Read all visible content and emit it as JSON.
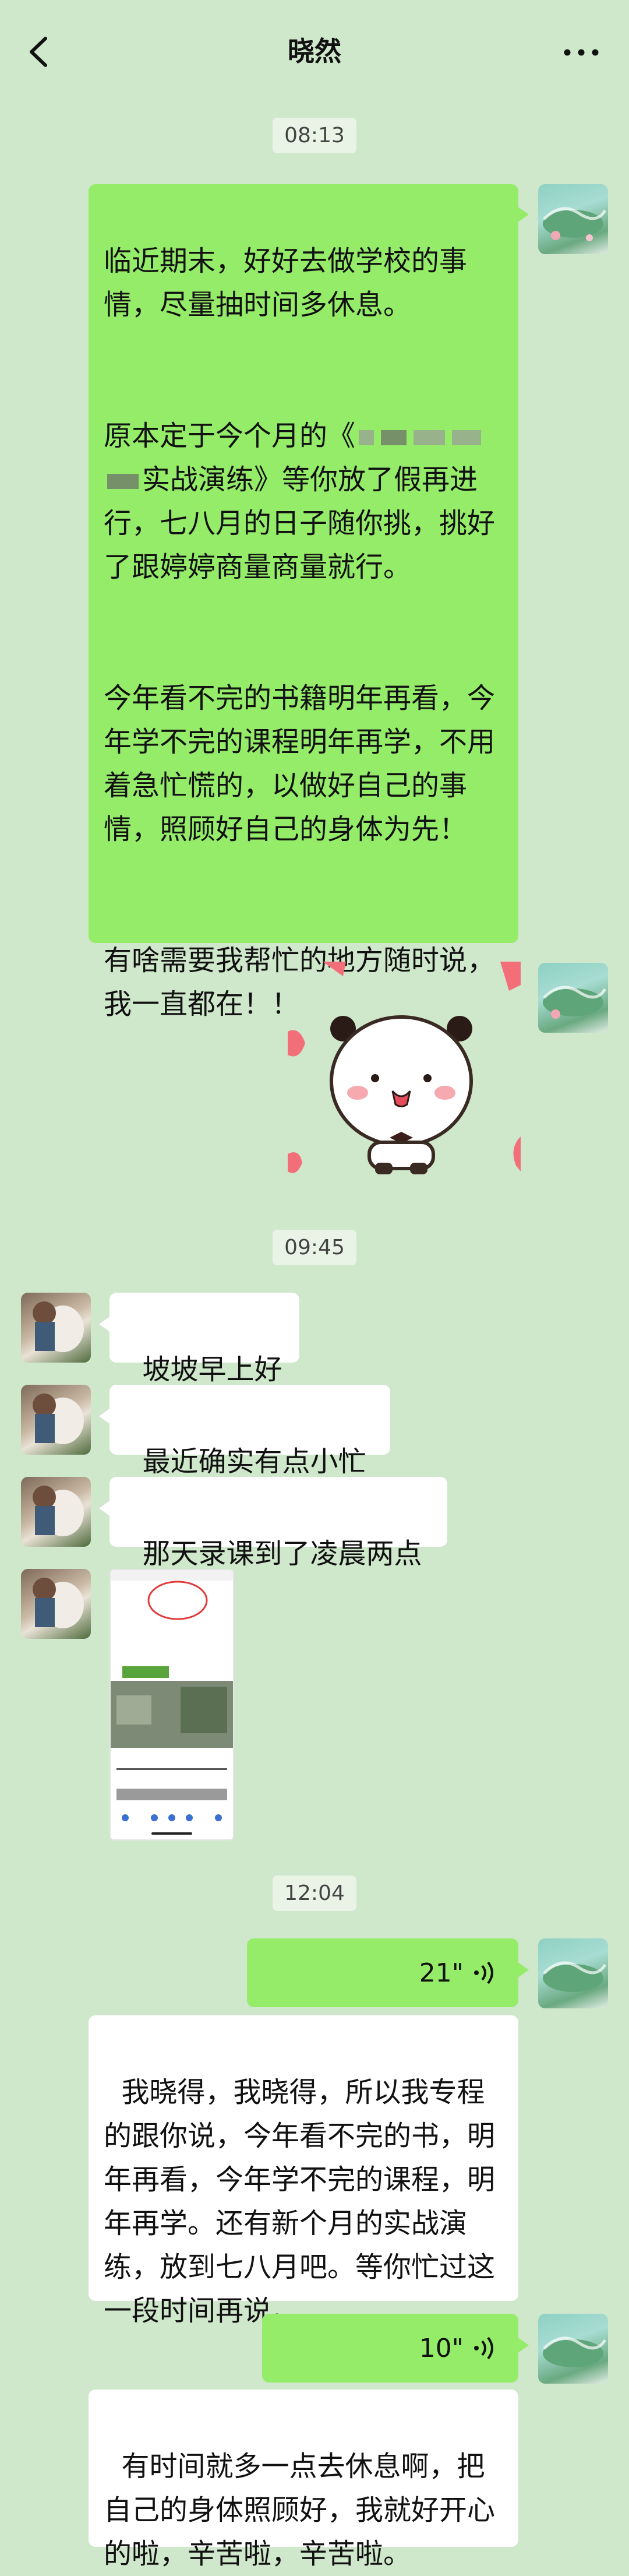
{
  "header": {
    "title": "晓然",
    "back_icon": "chevron-left-icon",
    "more_icon": "more-dots-icon"
  },
  "timestamps": [
    "08:13",
    "09:45",
    "12:04"
  ],
  "messages_block1": {
    "p1": "临近期末，好好去做学校的事情，尽量抽时间多休息。",
    "p2_a": "原本定于今个月的《",
    "p2_b": "实战演练》等你放了假再进行，七八月的日子随你挑，挑好了跟婷婷商量商量就行。",
    "p3": "今年看不完的书籍明年再看，今年学不完的课程明年再学，不用着急忙慌的，以做好自己的事情，照顾好自己的身体为先！",
    "p4": "有啥需要我帮忙的地方随时说，我一直都在！！"
  },
  "incoming": {
    "m1": "坡坡早上好",
    "m2": "最近确实有点小忙",
    "m3": "那天录课到了凌晨两点"
  },
  "voice": [
    {
      "duration": "21\"",
      "icon": "voice-wave-icon"
    },
    {
      "duration": "10\"",
      "icon": "voice-wave-icon"
    }
  ],
  "outgoing_later": {
    "m1": "我晓得，我晓得，所以我专程的跟你说，今年看不完的书，明年再看，今年学不完的课程，明年再学。还有新个月的实战演练，放到七八月吧。等你忙过这一段时间再说。",
    "m2": "有时间就多一点去休息啊，把自己的身体照顾好，我就好开心的啦，辛苦啦，辛苦啦。"
  },
  "colors": {
    "background": "#cfe7cb",
    "bubble_out": "#95ec69",
    "bubble_in": "#ffffff"
  }
}
